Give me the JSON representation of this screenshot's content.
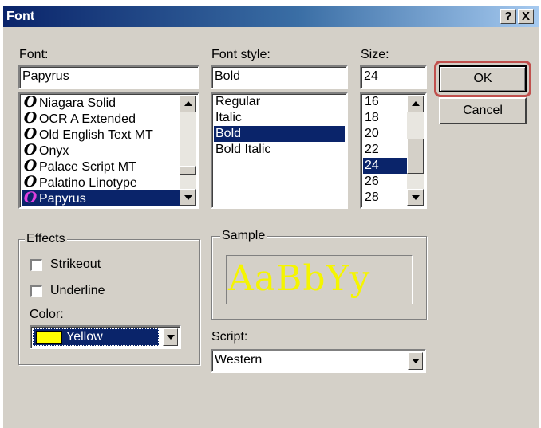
{
  "window": {
    "title": "Font",
    "help_button": "?",
    "close_button": "X"
  },
  "font": {
    "label": "Font:",
    "value": "Papyrus",
    "items": [
      {
        "name": "Niagara Solid",
        "icon": "opentype-font-icon",
        "selected": false
      },
      {
        "name": "OCR A Extended",
        "icon": "opentype-font-icon",
        "selected": false
      },
      {
        "name": "Old English Text MT",
        "icon": "opentype-font-icon",
        "selected": false
      },
      {
        "name": "Onyx",
        "icon": "opentype-font-icon",
        "selected": false
      },
      {
        "name": "Palace Script MT",
        "icon": "opentype-font-icon",
        "selected": false
      },
      {
        "name": "Palatino Linotype",
        "icon": "opentype-font-icon",
        "selected": false
      },
      {
        "name": "Papyrus",
        "icon": "opentype-font-icon",
        "selected": true
      }
    ],
    "icon_glyph": "O"
  },
  "style": {
    "label": "Font style:",
    "value": "Bold",
    "items": [
      {
        "name": "Regular",
        "selected": false
      },
      {
        "name": "Italic",
        "selected": false
      },
      {
        "name": "Bold",
        "selected": true
      },
      {
        "name": "Bold Italic",
        "selected": false
      }
    ]
  },
  "size": {
    "label": "Size:",
    "value": "24",
    "items": [
      {
        "name": "16",
        "selected": false
      },
      {
        "name": "18",
        "selected": false
      },
      {
        "name": "20",
        "selected": false
      },
      {
        "name": "22",
        "selected": false
      },
      {
        "name": "24",
        "selected": true
      },
      {
        "name": "26",
        "selected": false
      },
      {
        "name": "28",
        "selected": false
      }
    ]
  },
  "buttons": {
    "ok": "OK",
    "cancel": "Cancel"
  },
  "effects": {
    "label": "Effects",
    "strikeout": {
      "label": "Strikeout",
      "checked": false
    },
    "underline": {
      "label": "Underline",
      "checked": false
    },
    "color_label": "Color:",
    "color_value": "Yellow",
    "color_swatch": "#ffff00"
  },
  "sample": {
    "label": "Sample",
    "text": "AaBbYy",
    "color": "#f5f500"
  },
  "script": {
    "label": "Script:",
    "value": "Western"
  },
  "colors": {
    "dialog_bg": "#d4d0c8",
    "selection": "#0a246a",
    "annotation_ring": "#c0504d"
  }
}
